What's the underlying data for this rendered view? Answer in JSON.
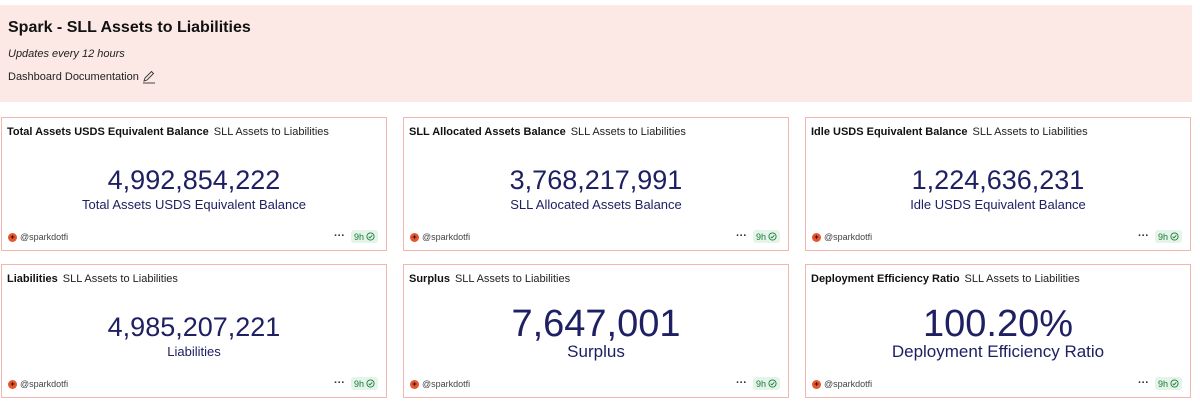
{
  "header": {
    "title": "Spark - SLL Assets to Liabilities",
    "subtitle": "Updates every 12 hours",
    "doc_link": "Dashboard Documentation"
  },
  "cards": [
    {
      "title": "Total Assets USDS Equivalent Balance",
      "subtitle": "SLL Assets to Liabilities",
      "value": "4,992,854,222",
      "label": "Total Assets USDS Equivalent Balance",
      "author": "@sparkdotfi",
      "more": "···",
      "updated": "9h"
    },
    {
      "title": "SLL Allocated Assets Balance",
      "subtitle": "SLL Assets to Liabilities",
      "value": "3,768,217,991",
      "label": "SLL Allocated Assets Balance",
      "author": "@sparkdotfi",
      "more": "···",
      "updated": "9h"
    },
    {
      "title": "Idle USDS Equivalent Balance",
      "subtitle": "SLL Assets to Liabilities",
      "value": "1,224,636,231",
      "label": "Idle USDS Equivalent Balance",
      "author": "@sparkdotfi",
      "more": "···",
      "updated": "9h"
    },
    {
      "title": "Liabilities",
      "subtitle": "SLL Assets to Liabilities",
      "value": "4,985,207,221",
      "label": "Liabilities",
      "author": "@sparkdotfi",
      "more": "···",
      "updated": "9h"
    },
    {
      "title": "Surplus",
      "subtitle": "SLL Assets to Liabilities",
      "value": "7,647,001",
      "label": "Surplus",
      "author": "@sparkdotfi",
      "more": "···",
      "updated": "9h"
    },
    {
      "title": "Deployment Efficiency Ratio",
      "subtitle": "SLL Assets to Liabilities",
      "value": "100.20%",
      "label": "Deployment Efficiency Ratio",
      "author": "@sparkdotfi",
      "more": "···",
      "updated": "9h"
    }
  ],
  "colors": {
    "header_bg": "#fce9e6",
    "card_border": "#f2b8b0",
    "value_text": "#1f2063",
    "badge_bg": "#e4f4e8",
    "badge_text": "#1b7a3a",
    "logo": "#e4572e"
  },
  "icons": {
    "doc_link": "pencil-icon",
    "author": "spark-logo-icon",
    "status": "check-circle-icon"
  }
}
